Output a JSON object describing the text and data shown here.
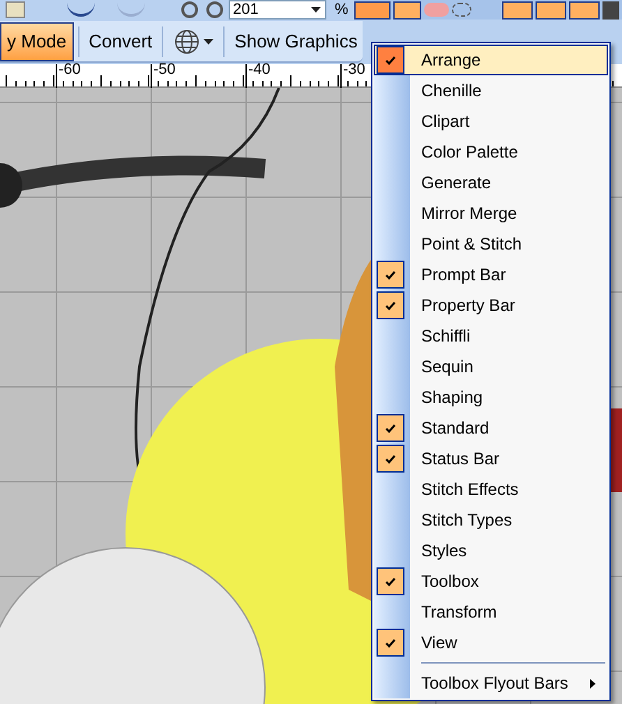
{
  "toolbar": {
    "zoom_value": "201",
    "zoom_unit": "%"
  },
  "mode_bar": {
    "buttons": [
      {
        "kind": "text",
        "label": "y Mode",
        "selected": true
      },
      {
        "kind": "text",
        "label": "Convert",
        "selected": false
      },
      {
        "kind": "globe",
        "selected": false
      },
      {
        "kind": "text",
        "label": "Show Graphics",
        "selected": false
      }
    ]
  },
  "ruler": {
    "labels": [
      "-60",
      "-50",
      "-40",
      "-30"
    ]
  },
  "menu": {
    "items": [
      {
        "kind": "item",
        "label": "Arrange",
        "checked": true,
        "selected": true
      },
      {
        "kind": "item",
        "label": "Chenille",
        "checked": false,
        "selected": false
      },
      {
        "kind": "item",
        "label": "Clipart",
        "checked": false,
        "selected": false
      },
      {
        "kind": "item",
        "label": "Color Palette",
        "checked": false,
        "selected": false
      },
      {
        "kind": "item",
        "label": "Generate",
        "checked": false,
        "selected": false
      },
      {
        "kind": "item",
        "label": "Mirror Merge",
        "checked": false,
        "selected": false
      },
      {
        "kind": "item",
        "label": "Point & Stitch",
        "checked": false,
        "selected": false
      },
      {
        "kind": "item",
        "label": "Prompt Bar",
        "checked": true,
        "selected": false
      },
      {
        "kind": "item",
        "label": "Property Bar",
        "checked": true,
        "selected": false
      },
      {
        "kind": "item",
        "label": "Schiffli",
        "checked": false,
        "selected": false
      },
      {
        "kind": "item",
        "label": "Sequin",
        "checked": false,
        "selected": false
      },
      {
        "kind": "item",
        "label": "Shaping",
        "checked": false,
        "selected": false
      },
      {
        "kind": "item",
        "label": "Standard",
        "checked": true,
        "selected": false
      },
      {
        "kind": "item",
        "label": "Status Bar",
        "checked": true,
        "selected": false
      },
      {
        "kind": "item",
        "label": "Stitch Effects",
        "checked": false,
        "selected": false
      },
      {
        "kind": "item",
        "label": "Stitch Types",
        "checked": false,
        "selected": false
      },
      {
        "kind": "item",
        "label": "Styles",
        "checked": false,
        "selected": false
      },
      {
        "kind": "item",
        "label": "Toolbox",
        "checked": true,
        "selected": false
      },
      {
        "kind": "item",
        "label": "Transform",
        "checked": false,
        "selected": false
      },
      {
        "kind": "item",
        "label": "View",
        "checked": true,
        "selected": false
      },
      {
        "kind": "separator"
      },
      {
        "kind": "submenu",
        "label": "Toolbox Flyout Bars",
        "checked": false,
        "selected": false
      }
    ]
  }
}
